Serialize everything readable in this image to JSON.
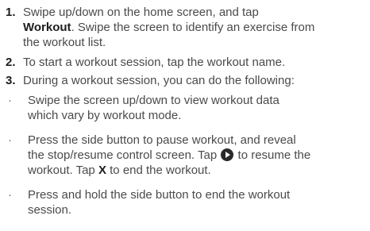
{
  "steps": [
    {
      "number": "1.",
      "line1": "Swipe up/down on the home screen, and tap",
      "bold": "Workout",
      "line2_rest": ". Swipe the screen to identify an exercise from",
      "line3": "the workout list."
    },
    {
      "number": "2.",
      "text": "To start a workout session, tap the workout name."
    },
    {
      "number": "3.",
      "text": "During a workout session, you can do the following:"
    }
  ],
  "bullets": [
    {
      "symbol": "·",
      "line1": "Swipe the screen up/down to view workout data",
      "line2": "which vary by workout mode."
    },
    {
      "symbol": "·",
      "line1": "Press the side button to pause workout, and reveal",
      "line2_a": "the stop/resume control screen. Tap",
      "line2_b": "to resume the",
      "line3_a": "workout. Tap",
      "line3_bold": "X",
      "line3_b": "to end the workout.",
      "play_icon": "play-circle-icon"
    },
    {
      "symbol": "·",
      "line1": "Press and hold the side button to end the workout",
      "line2": "session."
    }
  ]
}
